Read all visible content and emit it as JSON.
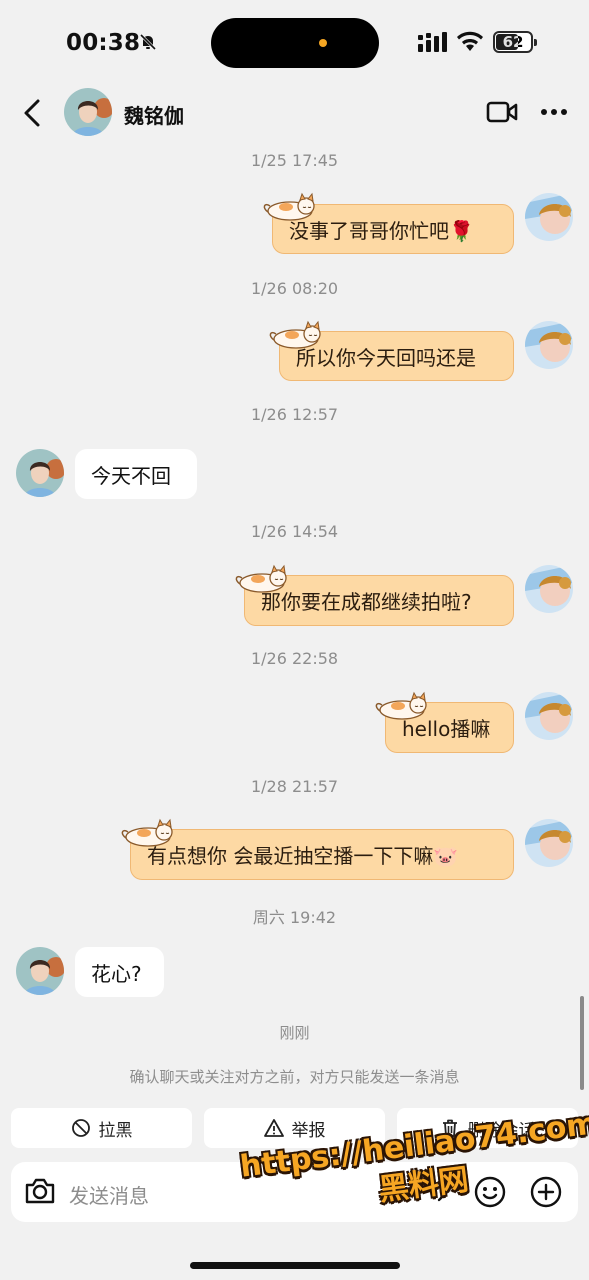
{
  "status_bar": {
    "time": "00:38",
    "battery": "62",
    "battery_level": 0.62
  },
  "header": {
    "contact_name": "魏铭伽"
  },
  "messages": [
    {
      "time": "1/25 17:45",
      "text": "没事了哥哥你忙吧🌹",
      "direction": "out"
    },
    {
      "time": "1/26 08:20",
      "text": "所以你今天回吗还是",
      "direction": "out"
    },
    {
      "time": "1/26 12:57",
      "text": "今天不回",
      "direction": "in"
    },
    {
      "time": "1/26 14:54",
      "text": "那你要在成都继续拍啦?",
      "direction": "out"
    },
    {
      "time": "1/26 22:58",
      "text": "hello播嘛",
      "direction": "out"
    },
    {
      "time": "1/28 21:57",
      "text": "有点想你 会最近抽空播一下下嘛🐷",
      "direction": "out"
    },
    {
      "time": "周六 19:42",
      "text": "花心?",
      "direction": "in"
    }
  ],
  "system": {
    "time": "刚刚",
    "notice": "确认聊天或关注对方之前，对方只能发送一条消息"
  },
  "actions": {
    "block": "拉黑",
    "report": "举报",
    "delete": "删除会话"
  },
  "input": {
    "placeholder": "发送消息"
  },
  "watermark": {
    "line1": "https://heiliao74.com",
    "line2": "黑料网"
  },
  "colors": {
    "bubble_out": "#fdd9a4",
    "bubble_border": "#f0b874",
    "background": "#f1f1f1",
    "watermark": "#f6a623"
  }
}
